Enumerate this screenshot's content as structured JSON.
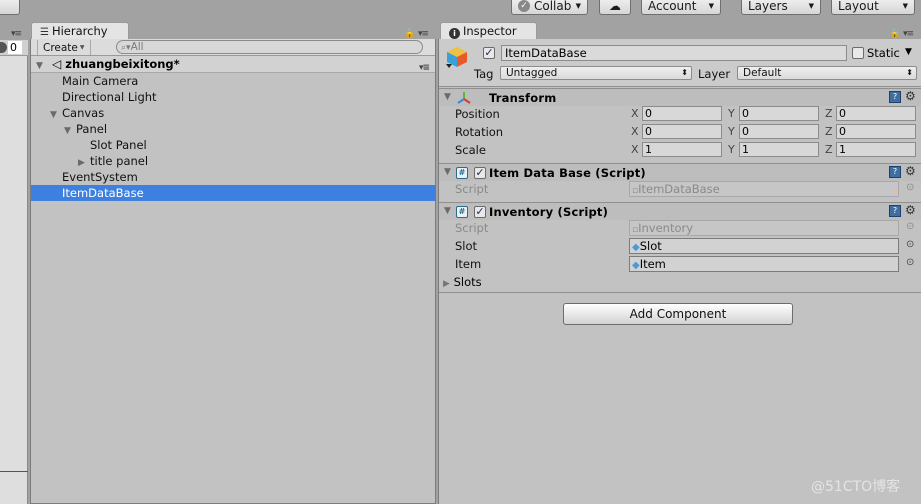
{
  "toolbar": {
    "collab_label": "Collab",
    "account_label": "Account",
    "layers_label": "Layers",
    "layout_label": "Layout"
  },
  "left_strip": {
    "count": "0"
  },
  "hierarchy": {
    "tab_label": "Hierarchy",
    "create_label": "Create",
    "search_placeholder": "All",
    "scene_name": "zhuangbeixitong*",
    "items": [
      {
        "label": "Main Camera",
        "depth": 0,
        "expander": "none"
      },
      {
        "label": "Directional Light",
        "depth": 0,
        "expander": "none"
      },
      {
        "label": "Canvas",
        "depth": 0,
        "expander": "expanded"
      },
      {
        "label": "Panel",
        "depth": 1,
        "expander": "expanded"
      },
      {
        "label": "Slot Panel",
        "depth": 2,
        "expander": "none"
      },
      {
        "label": "title panel",
        "depth": 2,
        "expander": "collapsed"
      },
      {
        "label": "EventSystem",
        "depth": 0,
        "expander": "none"
      },
      {
        "label": "ItemDataBase",
        "depth": 0,
        "expander": "none",
        "selected": true
      }
    ],
    "selection_color": "#3d80df"
  },
  "inspector": {
    "tab_label": "Inspector",
    "object_name": "ItemDataBase",
    "active": true,
    "static_label": "Static",
    "static_checked": false,
    "tag_label": "Tag",
    "tag_value": "Untagged",
    "layer_label": "Layer",
    "layer_value": "Default",
    "transform": {
      "title": "Transform",
      "rows": [
        {
          "label": "Position",
          "x": "0",
          "y": "0",
          "z": "0"
        },
        {
          "label": "Rotation",
          "x": "0",
          "y": "0",
          "z": "0"
        },
        {
          "label": "Scale",
          "x": "1",
          "y": "1",
          "z": "1"
        }
      ],
      "axis_x": "X",
      "axis_y": "Y",
      "axis_z": "Z"
    },
    "item_data_base": {
      "title": "Item Data Base (Script)",
      "enabled": true,
      "script_label": "Script",
      "script_value": "ItemDataBase"
    },
    "inventory": {
      "title": "Inventory (Script)",
      "enabled": true,
      "script_label": "Script",
      "script_value": "Inventory",
      "slot_label": "Slot",
      "slot_value": "Slot",
      "item_label": "Item",
      "item_value": "Item",
      "slots_label": "Slots"
    },
    "add_component_label": "Add Component"
  },
  "watermark": "@51CTO博客"
}
